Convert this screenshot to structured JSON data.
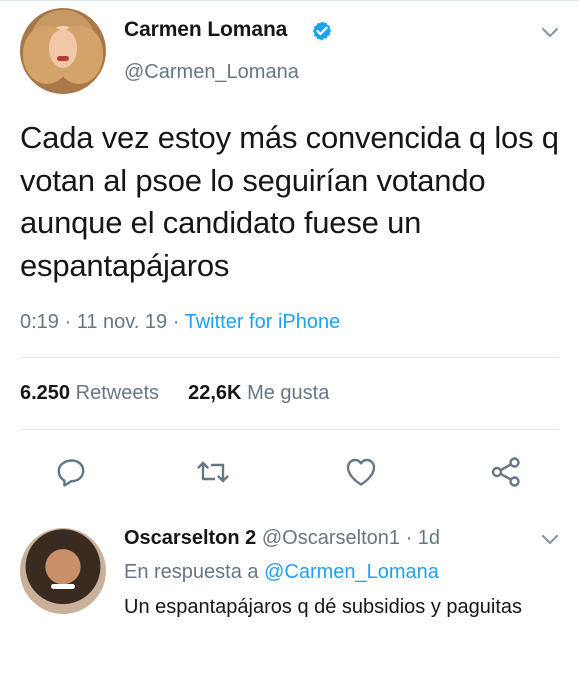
{
  "tweet": {
    "author_name": "Carmen Lomana",
    "author_handle": "@Carmen_Lomana",
    "verified": true,
    "text": "Cada vez estoy más convencida q los q votan al psoe lo seguirían votando aunque el candidato fuese un espantapájaros",
    "time": "0:19",
    "date": "11 nov. 19",
    "source": "Twitter for iPhone",
    "retweets_count": "6.250",
    "retweets_label": "Retweets",
    "likes_count": "22,6K",
    "likes_label": "Me gusta"
  },
  "actions": [
    {
      "name": "reply-icon"
    },
    {
      "name": "retweet-icon"
    },
    {
      "name": "like-icon"
    },
    {
      "name": "share-icon"
    }
  ],
  "reply": {
    "author_name": "Oscarselton 2",
    "author_handle": "@Oscarselton1",
    "age": "1d",
    "replying_prefix": "En respuesta a",
    "replying_to": "@Carmen_Lomana",
    "text": "Un espantapájaros q dé subsidios y paguitas"
  },
  "colors": {
    "accent": "#1da1f2",
    "muted": "#657786",
    "text": "#14171a",
    "divider": "#e1e8ed"
  }
}
